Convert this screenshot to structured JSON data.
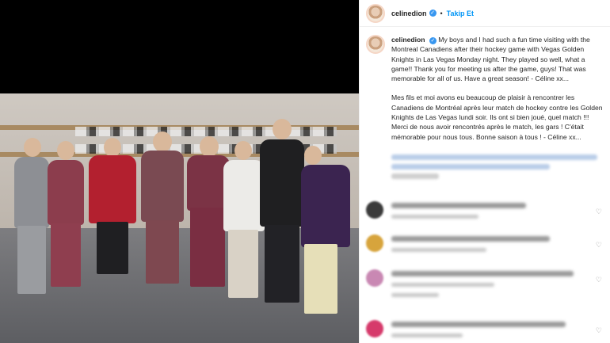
{
  "post": {
    "username": "celinedion",
    "follow_label": "Takip Et",
    "separator": "•",
    "caption_en": "My boys and I had such a fun time visiting with the Montreal Canadiens after their hockey game with Vegas Golden Knights in Las Vegas Monday night. They played so well, what a game!! Thank you for meeting us after the game, guys! That was memorable for all of us. Have a great season! - Céline xx...",
    "caption_fr": "Mes fils et moi avons eu beaucoup de plaisir à rencontrer les Canadiens de Montréal après leur match de hockey contre les Golden Knights de Las Vegas lundi soir. Ils ont si bien joué, quel match !!! Merci de nous avoir rencontrés après le match, les gars ! C'était mémorable pour nous tous. Bonne saison à tous ! - Céline xx..."
  },
  "colors": {
    "accent": "#0095f6",
    "verified": "#3897f0"
  },
  "icons": {
    "verified": "verified-badge-icon",
    "heart": "heart-icon"
  }
}
